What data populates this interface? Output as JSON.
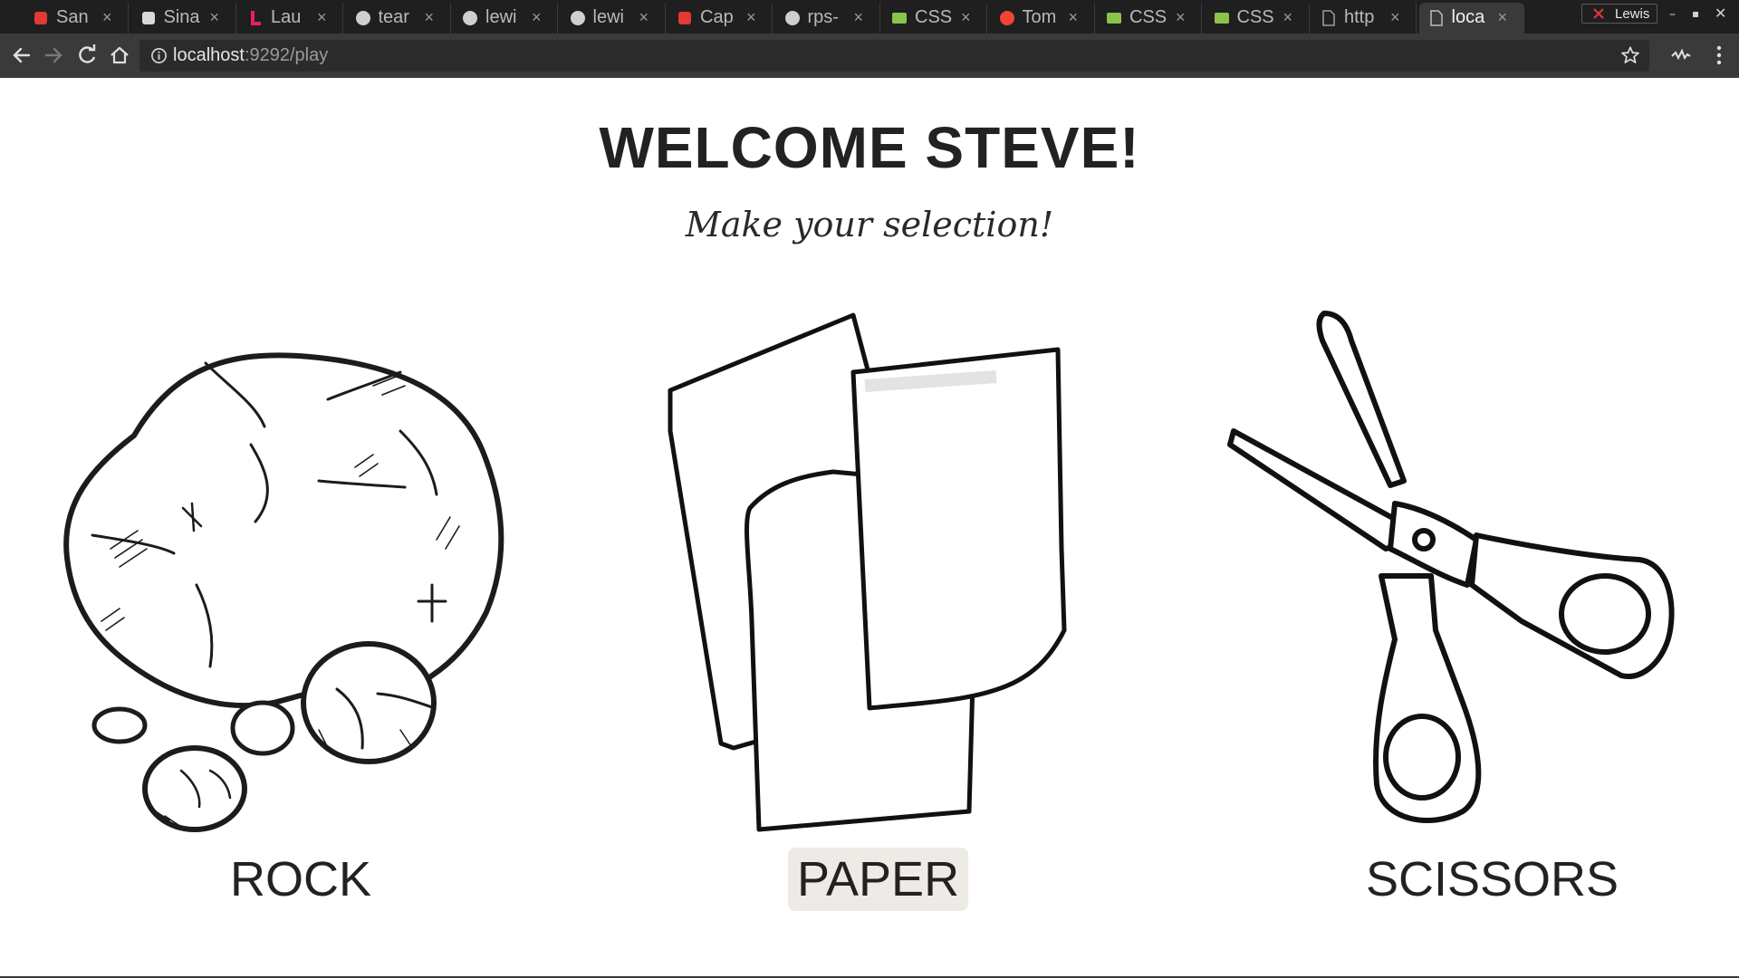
{
  "browser": {
    "tabs": [
      {
        "title": "San",
        "favicon": "red-bank-icon",
        "color": "#e53935"
      },
      {
        "title": "Sina",
        "favicon": "hat-icon",
        "color": "#d9d9d9"
      },
      {
        "title": "Lau",
        "favicon": "l-logo-icon",
        "color": "#e91e63"
      },
      {
        "title": "tear",
        "favicon": "github-icon",
        "color": "#cfcfcf"
      },
      {
        "title": "lewi",
        "favicon": "github-icon",
        "color": "#cfcfcf"
      },
      {
        "title": "lewi",
        "favicon": "github-icon",
        "color": "#cfcfcf"
      },
      {
        "title": "Cap",
        "favicon": "red-bank-icon",
        "color": "#e53935"
      },
      {
        "title": "rps-",
        "favicon": "github-icon",
        "color": "#cfcfcf"
      },
      {
        "title": "CSS",
        "favicon": "css-badge-icon",
        "color": "#8bc34a"
      },
      {
        "title": "Tom",
        "favicon": "tomato-icon",
        "color": "#f44336"
      },
      {
        "title": "CSS",
        "favicon": "css-badge-icon",
        "color": "#8bc34a"
      },
      {
        "title": "CSS",
        "favicon": "css-badge-icon",
        "color": "#8bc34a"
      },
      {
        "title": "http",
        "favicon": "page-icon",
        "color": "#9e9e9e"
      },
      {
        "title": "loca",
        "favicon": "page-icon",
        "color": "#bdbdbd"
      }
    ],
    "active_tab": 13,
    "close_glyph": "×",
    "profile_name": "Lewis",
    "url_host": "localhost",
    "url_rest": ":9292/play"
  },
  "game": {
    "welcome": "WELCOME STEVE!",
    "prompt": "Make your selection!",
    "choices": [
      {
        "label": "ROCK",
        "icon": "rock-illustration"
      },
      {
        "label": "PAPER",
        "icon": "paper-illustration"
      },
      {
        "label": "SCISSORS",
        "icon": "scissors-illustration"
      }
    ],
    "hovered_choice": "PAPER"
  }
}
